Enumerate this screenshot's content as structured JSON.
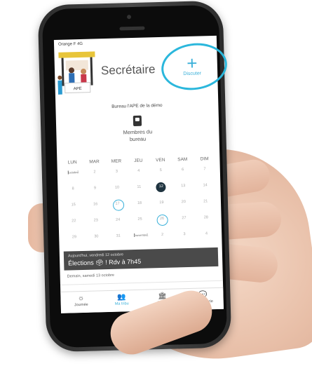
{
  "status_bar": {
    "carrier": "Orange F  4G"
  },
  "header": {
    "title": "Secrétaire",
    "discuter_icon": "+",
    "discuter_label": "Discuter"
  },
  "illustration": {
    "badge": "APE"
  },
  "subtitle": "Bureau l'APE de la démo",
  "members": {
    "label": "Membres du bureau"
  },
  "calendar": {
    "weekdays": [
      "LUN",
      "MAR",
      "MER",
      "JEU",
      "VEN",
      "SAM",
      "DIM"
    ],
    "rows": [
      [
        "1",
        "2",
        "3",
        "4",
        "5",
        "6",
        "7"
      ],
      [
        "8",
        "9",
        "10",
        "11",
        "12",
        "13",
        "14"
      ],
      [
        "15",
        "16",
        "17",
        "18",
        "19",
        "20",
        "21"
      ],
      [
        "22",
        "23",
        "24",
        "25",
        "26",
        "27",
        "28"
      ],
      [
        "29",
        "30",
        "31",
        "1",
        "2",
        "3",
        "4"
      ]
    ],
    "month_tag_1": "octobre",
    "month_tag_2": "novembre"
  },
  "event": {
    "date": "Aujourd'hui, vendredi 12 octobre",
    "text": "Élections 🗳 ! Rdv à 7h45"
  },
  "next_day": "Demain, samedi 13 octobre",
  "tabs": [
    {
      "label": "Journée",
      "icon": "☼"
    },
    {
      "label": "Ma tribu",
      "icon": "👥"
    },
    {
      "label": "Ecole",
      "icon": "🏛"
    },
    {
      "label": "Messagerie",
      "icon": "💬"
    }
  ]
}
